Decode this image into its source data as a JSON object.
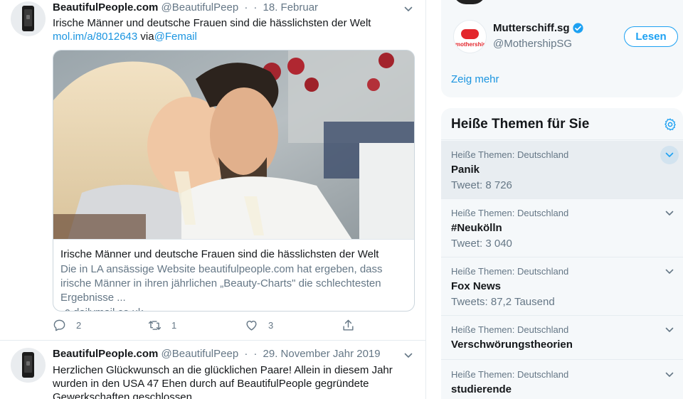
{
  "tweets": [
    {
      "name": "BeautifulPeople.com",
      "handle": "@BeautifulPeep",
      "separator": "·",
      "date": "18. Februar",
      "text": "Irische Männer und deutsche Frauen sind die hässlichsten der Welt",
      "link": "mol.im/a/8012643",
      "via_word": "via",
      "via_handle": "@Femail",
      "card": {
        "title": "Irische Männer und deutsche Frauen sind die hässlichsten der Welt",
        "description": "Die in LA ansässige Website beautifulpeople.com hat ergeben, dass irische Männer in ihren jährlichen „Beauty-Charts\" die schlechtesten Ergebnisse ...",
        "domain": "dailymail.co.uk"
      },
      "actions": {
        "replies": "2",
        "retweets": "1",
        "likes": "3"
      }
    },
    {
      "name": "BeautifulPeople.com",
      "handle": "@BeautifulPeep",
      "separator": "·",
      "date": "29. November Jahr 2019",
      "text": "Herzlichen Glückwunsch an die glücklichen Paare! Allein in diesem Jahr wurden in den USA 47 Ehen durch auf BeautifulPeople gegründete Gewerkschaften geschlossen."
    }
  ],
  "who_to_follow": {
    "name": "Mutterschiff.sg",
    "handle": "@MothershipSG",
    "logo_text": "mothership",
    "follow_label": "Lesen",
    "show_more": "Zeig mehr"
  },
  "trends": {
    "title": "Heiße Themen für Sie",
    "items": [
      {
        "meta": "Heiße Themen: Deutschland",
        "name": "Panik",
        "count": "Tweet: 8 726"
      },
      {
        "meta": "Heiße Themen: Deutschland",
        "name": "#Neukölln",
        "count": "Tweet: 3 040"
      },
      {
        "meta": "Heiße Themen: Deutschland",
        "name": "Fox News",
        "count": "Tweets: 87,2 Tausend"
      },
      {
        "meta": "Heiße Themen: Deutschland",
        "name": "Verschwörungstheorien",
        "count": ""
      },
      {
        "meta": "Heiße Themen: Deutschland",
        "name": "studierende",
        "count": ""
      }
    ]
  },
  "colors": {
    "accent": "#1da1f2",
    "link": "#1b95e0",
    "muted": "#657786",
    "sidebar_bg": "#f5f8fa",
    "brand_red": "#e3262c"
  },
  "icons": [
    "reply-icon",
    "retweet-icon",
    "like-icon",
    "share-icon",
    "caret-down-icon",
    "verified-icon",
    "gear-icon",
    "link-icon"
  ]
}
